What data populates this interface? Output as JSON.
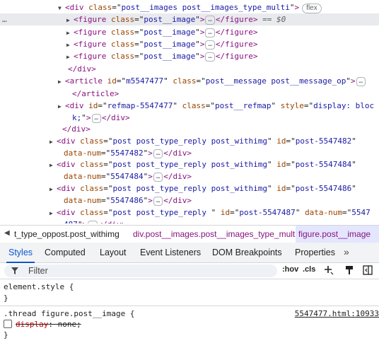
{
  "dom_lines": [
    {
      "indent": 92,
      "tri": "▼",
      "parts": [
        [
          "tag",
          "<div "
        ],
        [
          "an",
          "class"
        ],
        [
          "eq",
          "=\""
        ],
        [
          "av",
          "post__images  post__images_type_multi"
        ],
        [
          "eq",
          "\""
        ],
        [
          "tag",
          ">"
        ]
      ],
      "badge": "flex"
    },
    {
      "indent": 104,
      "tri": "▶",
      "parts": [
        [
          "tag",
          "<figure "
        ],
        [
          "an",
          "class"
        ],
        [
          "eq",
          "=\""
        ],
        [
          "av",
          "post__image"
        ],
        [
          "eq",
          "\""
        ],
        [
          "tag",
          ">"
        ]
      ],
      "pill": "…",
      "after": [
        [
          "tag",
          "</figure>"
        ]
      ],
      "eq0": " == $0",
      "selected": true,
      "leftdots": "…"
    },
    {
      "indent": 104,
      "tri": "▶",
      "parts": [
        [
          "tag",
          "<figure "
        ],
        [
          "an",
          "class"
        ],
        [
          "eq",
          "=\""
        ],
        [
          "av",
          "post__image"
        ],
        [
          "eq",
          "\""
        ],
        [
          "tag",
          ">"
        ]
      ],
      "pill": "…",
      "after": [
        [
          "tag",
          "</figure>"
        ]
      ]
    },
    {
      "indent": 104,
      "tri": "▶",
      "parts": [
        [
          "tag",
          "<figure "
        ],
        [
          "an",
          "class"
        ],
        [
          "eq",
          "=\""
        ],
        [
          "av",
          "post__image"
        ],
        [
          "eq",
          "\""
        ],
        [
          "tag",
          ">"
        ]
      ],
      "pill": "…",
      "after": [
        [
          "tag",
          "</figure>"
        ]
      ]
    },
    {
      "indent": 104,
      "tri": "▶",
      "parts": [
        [
          "tag",
          "<figure "
        ],
        [
          "an",
          "class"
        ],
        [
          "eq",
          "=\""
        ],
        [
          "av",
          "post__image"
        ],
        [
          "eq",
          "\""
        ],
        [
          "tag",
          ">"
        ]
      ],
      "pill": "…",
      "after": [
        [
          "tag",
          "</figure>"
        ]
      ]
    },
    {
      "indent": 96,
      "tri": "",
      "parts": [
        [
          "tag",
          "</div>"
        ]
      ]
    },
    {
      "indent": 92,
      "tri": "▶",
      "parts": [
        [
          "tag",
          "<article "
        ],
        [
          "an",
          "id"
        ],
        [
          "eq",
          "=\""
        ],
        [
          "av",
          "m5547477"
        ],
        [
          "eq",
          "\" "
        ],
        [
          "an",
          "class"
        ],
        [
          "eq",
          "=\""
        ],
        [
          "av",
          "post__message post__message_op"
        ],
        [
          "eq",
          "\""
        ],
        [
          "tag",
          ">"
        ]
      ],
      "pill": "…"
    },
    {
      "indent": 102,
      "tri": "",
      "parts": [
        [
          "tag",
          "</article>"
        ]
      ]
    },
    {
      "indent": 92,
      "tri": "▶",
      "parts": [
        [
          "tag",
          "<div "
        ],
        [
          "an",
          "id"
        ],
        [
          "eq",
          "=\""
        ],
        [
          "av",
          "refmap-5547477"
        ],
        [
          "eq",
          "\" "
        ],
        [
          "an",
          "class"
        ],
        [
          "eq",
          "=\""
        ],
        [
          "av",
          "post__refmap"
        ],
        [
          "eq",
          "\" "
        ],
        [
          "an",
          "style"
        ],
        [
          "eq",
          "=\""
        ],
        [
          "av",
          "display: bloc"
        ]
      ]
    },
    {
      "indent": 102,
      "tri": "",
      "parts": [
        [
          "av",
          "k;"
        ],
        [
          "eq",
          "\""
        ],
        [
          "tag",
          ">"
        ]
      ],
      "pill": "…",
      "after": [
        [
          "tag",
          "</div>"
        ]
      ]
    },
    {
      "indent": 88,
      "tri": "",
      "parts": [
        [
          "tag",
          "</div>"
        ]
      ]
    },
    {
      "indent": 80,
      "tri": "▶",
      "parts": [
        [
          "tag",
          "<div "
        ],
        [
          "an",
          "class"
        ],
        [
          "eq",
          "=\""
        ],
        [
          "av",
          "post post_type_reply  post_withimg"
        ],
        [
          "eq",
          "\" "
        ],
        [
          "an",
          "id"
        ],
        [
          "eq",
          "=\""
        ],
        [
          "av",
          "post-5547482"
        ],
        [
          "eq",
          "\""
        ]
      ]
    },
    {
      "indent": 90,
      "tri": "",
      "parts": [
        [
          "an",
          "data-num"
        ],
        [
          "eq",
          "=\""
        ],
        [
          "av",
          "5547482"
        ],
        [
          "eq",
          "\""
        ],
        [
          "tag",
          ">"
        ]
      ],
      "pill": "…",
      "after": [
        [
          "tag",
          "</div>"
        ]
      ]
    },
    {
      "indent": 80,
      "tri": "▶",
      "parts": [
        [
          "tag",
          "<div "
        ],
        [
          "an",
          "class"
        ],
        [
          "eq",
          "=\""
        ],
        [
          "av",
          "post post_type_reply  post_withimg"
        ],
        [
          "eq",
          "\" "
        ],
        [
          "an",
          "id"
        ],
        [
          "eq",
          "=\""
        ],
        [
          "av",
          "post-5547484"
        ],
        [
          "eq",
          "\""
        ]
      ]
    },
    {
      "indent": 90,
      "tri": "",
      "parts": [
        [
          "an",
          "data-num"
        ],
        [
          "eq",
          "=\""
        ],
        [
          "av",
          "5547484"
        ],
        [
          "eq",
          "\""
        ],
        [
          "tag",
          ">"
        ]
      ],
      "pill": "…",
      "after": [
        [
          "tag",
          "</div>"
        ]
      ]
    },
    {
      "indent": 80,
      "tri": "▶",
      "parts": [
        [
          "tag",
          "<div "
        ],
        [
          "an",
          "class"
        ],
        [
          "eq",
          "=\""
        ],
        [
          "av",
          "post post_type_reply  post_withimg"
        ],
        [
          "eq",
          "\" "
        ],
        [
          "an",
          "id"
        ],
        [
          "eq",
          "=\""
        ],
        [
          "av",
          "post-5547486"
        ],
        [
          "eq",
          "\""
        ]
      ]
    },
    {
      "indent": 90,
      "tri": "",
      "parts": [
        [
          "an",
          "data-num"
        ],
        [
          "eq",
          "=\""
        ],
        [
          "av",
          "5547486"
        ],
        [
          "eq",
          "\""
        ],
        [
          "tag",
          ">"
        ]
      ],
      "pill": "…",
      "after": [
        [
          "tag",
          "</div>"
        ]
      ]
    },
    {
      "indent": 80,
      "tri": "▶",
      "parts": [
        [
          "tag",
          "<div "
        ],
        [
          "an",
          "class"
        ],
        [
          "eq",
          "=\""
        ],
        [
          "av",
          "post post_type_reply  "
        ],
        [
          "eq",
          "\" "
        ],
        [
          "an",
          "id"
        ],
        [
          "eq",
          "=\""
        ],
        [
          "av",
          "post-5547487"
        ],
        [
          "eq",
          "\" "
        ],
        [
          "an",
          "data-num"
        ],
        [
          "eq",
          "=\""
        ],
        [
          "av",
          "5547"
        ]
      ]
    },
    {
      "indent": 90,
      "tri": "",
      "parts": [
        [
          "av",
          "487"
        ],
        [
          "eq",
          "\""
        ],
        [
          "tag",
          ">"
        ]
      ],
      "pill": "…",
      "after": [
        [
          "tag",
          "</div>"
        ]
      ]
    }
  ],
  "breadcrumbs": {
    "arrow": "◀",
    "items": [
      "t_type_oppost.post_withimg",
      "div.post__images.post__images_type_multi",
      "figure.post__image"
    ]
  },
  "tabs": [
    "Styles",
    "Computed",
    "Layout",
    "Event Listeners",
    "DOM Breakpoints",
    "Properties"
  ],
  "tabs_more": "»",
  "filter": {
    "placeholder": "Filter",
    "hov": ":hov",
    "cls": ".cls"
  },
  "styles": {
    "element_style_selector": "element.style {",
    "element_style_close": "}",
    "rule_selector": ".thread figure.post__image {",
    "rule_source": "5547477.html:10933",
    "rule_prop": "display",
    "rule_value": "none;",
    "rule_close": "}"
  },
  "colors": {
    "tag": "#881280",
    "attr_name": "#994500",
    "attr_value": "#1a1aa6",
    "active_tab": "#0b57d0"
  }
}
